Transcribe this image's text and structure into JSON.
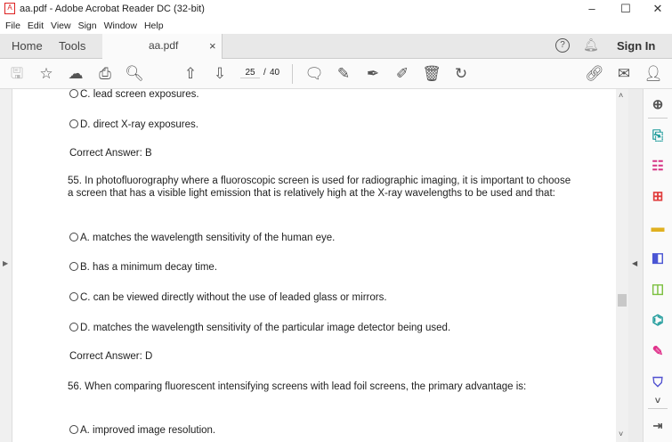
{
  "window": {
    "title": "aa.pdf - Adobe Acrobat Reader DC (32-bit)",
    "minimize": "–",
    "maximize": "☐",
    "close": "✕"
  },
  "menu": [
    "File",
    "Edit",
    "View",
    "Sign",
    "Window",
    "Help"
  ],
  "tabs": {
    "home": "Home",
    "tools": "Tools",
    "doc": "aa.pdf",
    "close": "×",
    "sign_in": "Sign In"
  },
  "toolbar": {
    "page_current": "25",
    "page_sep": "/",
    "page_total": "40"
  },
  "content": {
    "lines": [
      {
        "text": "C. lead screen exposures.",
        "option": true
      },
      {
        "text": "D. direct X-ray exposures.",
        "option": true
      },
      {
        "text": "Correct Answer: B",
        "option": false
      },
      {
        "text": "55. In photofluorography where a fluoroscopic screen is used for radiographic imaging, it is important to choose",
        "option": false
      },
      {
        "text": "a screen that has a visible light emission that is relatively high at the X-ray wavelengths to be used and that:",
        "option": false
      },
      {
        "text": "A. matches the wavelength sensitivity of the human eye.",
        "option": true
      },
      {
        "text": "B. has a minimum decay time.",
        "option": true
      },
      {
        "text": "C. can be viewed directly without the use of leaded glass or mirrors.",
        "option": true
      },
      {
        "text": "D. matches the wavelength sensitivity of the particular image detector being used.",
        "option": true
      },
      {
        "text": "Correct Answer: D",
        "option": false
      },
      {
        "text": "56. When comparing fluorescent intensifying screens with lead foil screens, the primary advantage is:",
        "option": false
      },
      {
        "text": "A. improved image resolution.",
        "option": true
      }
    ]
  },
  "right_panel_icons": [
    {
      "name": "zoom-icon",
      "color": "#555"
    },
    {
      "name": "export-pdf-icon",
      "color": "#1b9a9a"
    },
    {
      "name": "organize-pages-icon",
      "color": "#d63384"
    },
    {
      "name": "create-pdf-icon",
      "color": "#e03c3c"
    },
    {
      "name": "comment-icon",
      "color": "#e0b020"
    },
    {
      "name": "combine-files-icon",
      "color": "#4a55d4"
    },
    {
      "name": "compress-icon",
      "color": "#7cc040"
    },
    {
      "name": "scan-icon",
      "color": "#1b9a9a"
    },
    {
      "name": "fill-sign-icon",
      "color": "#e0308a"
    },
    {
      "name": "protect-icon",
      "color": "#5050d0"
    }
  ]
}
